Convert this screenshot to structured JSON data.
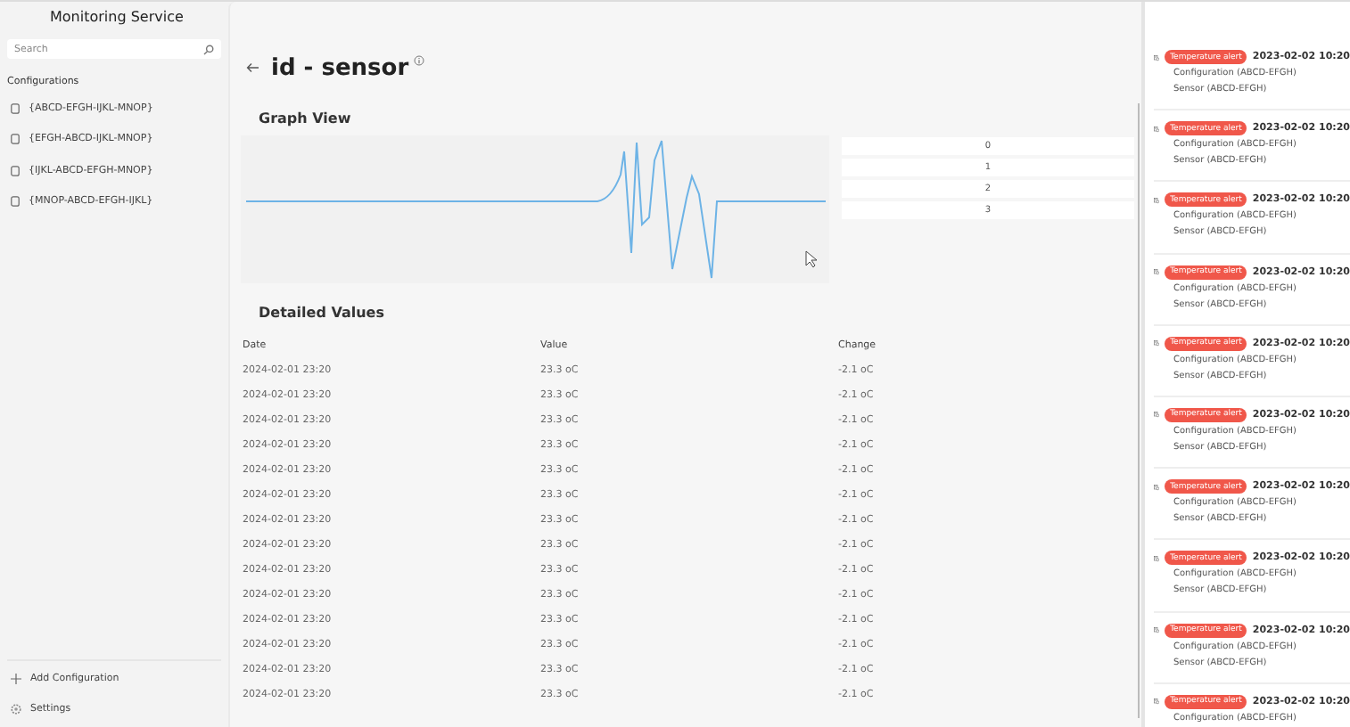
{
  "window": {
    "title": "Monitoring Service"
  },
  "sidebar": {
    "search": {
      "placeholder": "Search"
    },
    "section_title": "Configurations",
    "items": [
      {
        "label": "{ABCD-EFGH-IJKL-MNOP}"
      },
      {
        "label": "{EFGH-ABCD-IJKL-MNOP}"
      },
      {
        "label": "{IJKL-ABCD-EFGH-MNOP}"
      },
      {
        "label": "{MNOP-ABCD-EFGH-IJKL}"
      }
    ],
    "footer": [
      {
        "kind": "add",
        "label": "Add Configuration"
      },
      {
        "kind": "settings",
        "label": "Settings"
      }
    ]
  },
  "page": {
    "title": "id - sensor",
    "graph_title": "Graph View",
    "legend": [
      "0",
      "1",
      "2",
      "3"
    ],
    "table_title": "Detailed Values",
    "table": {
      "columns": [
        "Date",
        "Value",
        "Change"
      ],
      "rows": [
        [
          "2024-02-01 23:20",
          "23.3 oC",
          "-2.1 oC"
        ],
        [
          "2024-02-01 23:20",
          "23.3 oC",
          "-2.1 oC"
        ],
        [
          "2024-02-01 23:20",
          "23.3 oC",
          "-2.1 oC"
        ],
        [
          "2024-02-01 23:20",
          "23.3 oC",
          "-2.1 oC"
        ],
        [
          "2024-02-01 23:20",
          "23.3 oC",
          "-2.1 oC"
        ],
        [
          "2024-02-01 23:20",
          "23.3 oC",
          "-2.1 oC"
        ],
        [
          "2024-02-01 23:20",
          "23.3 oC",
          "-2.1 oC"
        ],
        [
          "2024-02-01 23:20",
          "23.3 oC",
          "-2.1 oC"
        ],
        [
          "2024-02-01 23:20",
          "23.3 oC",
          "-2.1 oC"
        ],
        [
          "2024-02-01 23:20",
          "23.3 oC",
          "-2.1 oC"
        ],
        [
          "2024-02-01 23:20",
          "23.3 oC",
          "-2.1 oC"
        ],
        [
          "2024-02-01 23:20",
          "23.3 oC",
          "-2.1 oC"
        ],
        [
          "2024-02-01 23:20",
          "23.3 oC",
          "-2.1 oC"
        ],
        [
          "2024-02-01 23:20",
          "23.3 oC",
          "-2.1 oC"
        ]
      ]
    }
  },
  "alerts": [
    {
      "badge": "Temperature alert",
      "time": "2023-02-02 10:20",
      "configuration": "Configuration (ABCD-EFGH)",
      "sensor": "Sensor (ABCD-EFGH)"
    },
    {
      "badge": "Temperature alert",
      "time": "2023-02-02 10:20",
      "configuration": "Configuration (ABCD-EFGH)",
      "sensor": "Sensor (ABCD-EFGH)"
    },
    {
      "badge": "Temperature alert",
      "time": "2023-02-02 10:20",
      "configuration": "Configuration (ABCD-EFGH)",
      "sensor": "Sensor (ABCD-EFGH)"
    },
    {
      "badge": "Temperature alert",
      "time": "2023-02-02 10:20",
      "configuration": "Configuration (ABCD-EFGH)",
      "sensor": "Sensor (ABCD-EFGH)"
    },
    {
      "badge": "Temperature alert",
      "time": "2023-02-02 10:20",
      "configuration": "Configuration (ABCD-EFGH)",
      "sensor": "Sensor (ABCD-EFGH)"
    },
    {
      "badge": "Temperature alert",
      "time": "2023-02-02 10:20",
      "configuration": "Configuration (ABCD-EFGH)",
      "sensor": "Sensor (ABCD-EFGH)"
    },
    {
      "badge": "Temperature alert",
      "time": "2023-02-02 10:20",
      "configuration": "Configuration (ABCD-EFGH)",
      "sensor": "Sensor (ABCD-EFGH)"
    },
    {
      "badge": "Temperature alert",
      "time": "2023-02-02 10:20",
      "configuration": "Configuration (ABCD-EFGH)",
      "sensor": "Sensor (ABCD-EFGH)"
    },
    {
      "badge": "Temperature alert",
      "time": "2023-02-02 10:20",
      "configuration": "Configuration (ABCD-EFGH)",
      "sensor": "Sensor (ABCD-EFGH)"
    },
    {
      "badge": "Temperature alert",
      "time": "2023-02-02 10:20",
      "configuration": "Configuration (ABCD-EFGH)"
    }
  ]
}
